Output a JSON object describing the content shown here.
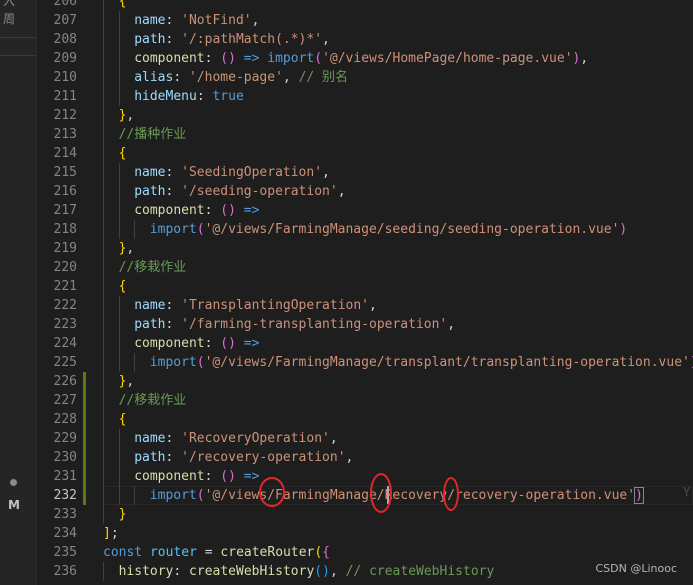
{
  "left_strip": {
    "texts": [
      "入",
      "周"
    ],
    "modified_badge": "M"
  },
  "colors": {
    "string": "#ce9178",
    "property": "#9cdcfe",
    "keyword": "#569cd6",
    "function": "#dcdcaa",
    "comment": "#6a9955",
    "annotation_circle": "#e8242a"
  },
  "lines": [
    {
      "n": "206",
      "indent": 1,
      "toks": [
        [
          "p1",
          "{"
        ]
      ]
    },
    {
      "n": "207",
      "indent": 2,
      "toks": [
        [
          "prop",
          "name"
        ],
        [
          "pun",
          ": "
        ],
        [
          "str",
          "'NotFind'"
        ],
        [
          "pun",
          ","
        ]
      ]
    },
    {
      "n": "208",
      "indent": 2,
      "toks": [
        [
          "prop",
          "path"
        ],
        [
          "pun",
          ": "
        ],
        [
          "str",
          "'/:pathMatch(.*)*'"
        ],
        [
          "pun",
          ","
        ]
      ]
    },
    {
      "n": "209",
      "indent": 2,
      "toks": [
        [
          "fn",
          "component"
        ],
        [
          "pun",
          ": "
        ],
        [
          "p2",
          "()"
        ],
        [
          "pun",
          " "
        ],
        [
          "kw",
          "=>"
        ],
        [
          "pun",
          " "
        ],
        [
          "kw",
          "import"
        ],
        [
          "p2",
          "("
        ],
        [
          "str",
          "'@/views/HomePage/home-page.vue'"
        ],
        [
          "p2",
          ")"
        ],
        [
          "pun",
          ","
        ]
      ]
    },
    {
      "n": "210",
      "indent": 2,
      "toks": [
        [
          "prop",
          "alias"
        ],
        [
          "pun",
          ": "
        ],
        [
          "str",
          "'/home-page'"
        ],
        [
          "pun",
          ", "
        ],
        [
          "cm",
          "// 别名"
        ]
      ]
    },
    {
      "n": "211",
      "indent": 2,
      "toks": [
        [
          "prop",
          "hideMenu"
        ],
        [
          "pun",
          ": "
        ],
        [
          "kw",
          "true"
        ]
      ]
    },
    {
      "n": "212",
      "indent": 1,
      "toks": [
        [
          "p1",
          "}"
        ],
        [
          "pun",
          ","
        ]
      ]
    },
    {
      "n": "213",
      "indent": 1,
      "toks": [
        [
          "cm",
          "//播种作业"
        ]
      ]
    },
    {
      "n": "214",
      "indent": 1,
      "toks": [
        [
          "p1",
          "{"
        ]
      ]
    },
    {
      "n": "215",
      "indent": 2,
      "toks": [
        [
          "prop",
          "name"
        ],
        [
          "pun",
          ": "
        ],
        [
          "str",
          "'SeedingOperation'"
        ],
        [
          "pun",
          ","
        ]
      ]
    },
    {
      "n": "216",
      "indent": 2,
      "toks": [
        [
          "prop",
          "path"
        ],
        [
          "pun",
          ": "
        ],
        [
          "str",
          "'/seeding-operation'"
        ],
        [
          "pun",
          ","
        ]
      ]
    },
    {
      "n": "217",
      "indent": 2,
      "toks": [
        [
          "fn",
          "component"
        ],
        [
          "pun",
          ": "
        ],
        [
          "p2",
          "()"
        ],
        [
          "pun",
          " "
        ],
        [
          "kw",
          "=>"
        ]
      ]
    },
    {
      "n": "218",
      "indent": 3,
      "toks": [
        [
          "kw",
          "import"
        ],
        [
          "p2",
          "("
        ],
        [
          "str",
          "'@/views/FarmingManage/seeding/seeding-operation.vue'"
        ],
        [
          "p2",
          ")"
        ]
      ]
    },
    {
      "n": "219",
      "indent": 1,
      "toks": [
        [
          "p1",
          "}"
        ],
        [
          "pun",
          ","
        ]
      ]
    },
    {
      "n": "220",
      "indent": 1,
      "toks": [
        [
          "cm",
          "//移栽作业"
        ]
      ]
    },
    {
      "n": "221",
      "indent": 1,
      "toks": [
        [
          "p1",
          "{"
        ]
      ]
    },
    {
      "n": "222",
      "indent": 2,
      "toks": [
        [
          "prop",
          "name"
        ],
        [
          "pun",
          ": "
        ],
        [
          "str",
          "'TransplantingOperation'"
        ],
        [
          "pun",
          ","
        ]
      ]
    },
    {
      "n": "223",
      "indent": 2,
      "toks": [
        [
          "prop",
          "path"
        ],
        [
          "pun",
          ": "
        ],
        [
          "str",
          "'/farming-transplanting-operation'"
        ],
        [
          "pun",
          ","
        ]
      ]
    },
    {
      "n": "224",
      "indent": 2,
      "toks": [
        [
          "fn",
          "component"
        ],
        [
          "pun",
          ": "
        ],
        [
          "p2",
          "()"
        ],
        [
          "pun",
          " "
        ],
        [
          "kw",
          "=>"
        ]
      ]
    },
    {
      "n": "225",
      "indent": 3,
      "toks": [
        [
          "kw",
          "import"
        ],
        [
          "p2",
          "("
        ],
        [
          "str",
          "'@/views/FarmingManage/transplant/transplanting-operation.vue'"
        ],
        [
          "p2",
          ")"
        ]
      ]
    },
    {
      "n": "226",
      "indent": 1,
      "mark": true,
      "toks": [
        [
          "p1",
          "}"
        ],
        [
          "pun",
          ","
        ]
      ]
    },
    {
      "n": "227",
      "indent": 1,
      "mark": true,
      "toks": [
        [
          "cm",
          "//移栽作业"
        ]
      ]
    },
    {
      "n": "228",
      "indent": 1,
      "mark": true,
      "toks": [
        [
          "p1",
          "{"
        ]
      ]
    },
    {
      "n": "229",
      "indent": 2,
      "mark": true,
      "toks": [
        [
          "prop",
          "name"
        ],
        [
          "pun",
          ": "
        ],
        [
          "str",
          "'RecoveryOperation'"
        ],
        [
          "pun",
          ","
        ]
      ]
    },
    {
      "n": "230",
      "indent": 2,
      "mark": true,
      "toks": [
        [
          "prop",
          "path"
        ],
        [
          "pun",
          ": "
        ],
        [
          "str",
          "'/recovery-operation'"
        ],
        [
          "pun",
          ","
        ]
      ]
    },
    {
      "n": "231",
      "indent": 2,
      "mark": true,
      "toks": [
        [
          "fn",
          "component"
        ],
        [
          "pun",
          ": "
        ],
        [
          "p2",
          "()"
        ],
        [
          "pun",
          " "
        ],
        [
          "kw",
          "=>"
        ]
      ]
    },
    {
      "n": "232",
      "indent": 3,
      "mark": true,
      "current": true,
      "toks": [
        [
          "kw",
          "import"
        ],
        [
          "p2",
          "("
        ],
        [
          "str",
          "'@/views/FarmingManage/Recovery/recovery-operation.vue'"
        ],
        [
          "p2m",
          ")"
        ]
      ]
    },
    {
      "n": "233",
      "indent": 1,
      "toks": [
        [
          "p1",
          "}"
        ]
      ]
    },
    {
      "n": "234",
      "indent": 0,
      "toks": [
        [
          "p1",
          "]"
        ],
        [
          "pun",
          ";"
        ]
      ]
    },
    {
      "n": "235",
      "indent": 0,
      "toks": [
        [
          "kw",
          "const"
        ],
        [
          "pun",
          " "
        ],
        [
          "const",
          "router"
        ],
        [
          "pun",
          " = "
        ],
        [
          "fn",
          "createRouter"
        ],
        [
          "p1",
          "("
        ],
        [
          "p2",
          "{"
        ]
      ]
    },
    {
      "n": "236",
      "indent": 1,
      "toks": [
        [
          "fn",
          "history"
        ],
        [
          "pun",
          ": "
        ],
        [
          "fn",
          "createWebHistory"
        ],
        [
          "p3",
          "()"
        ],
        [
          "pun",
          ", "
        ],
        [
          "cm",
          "// createWebHistory"
        ]
      ]
    }
  ],
  "watermark": "CSDN @Linooc",
  "ghost_char": "Y"
}
